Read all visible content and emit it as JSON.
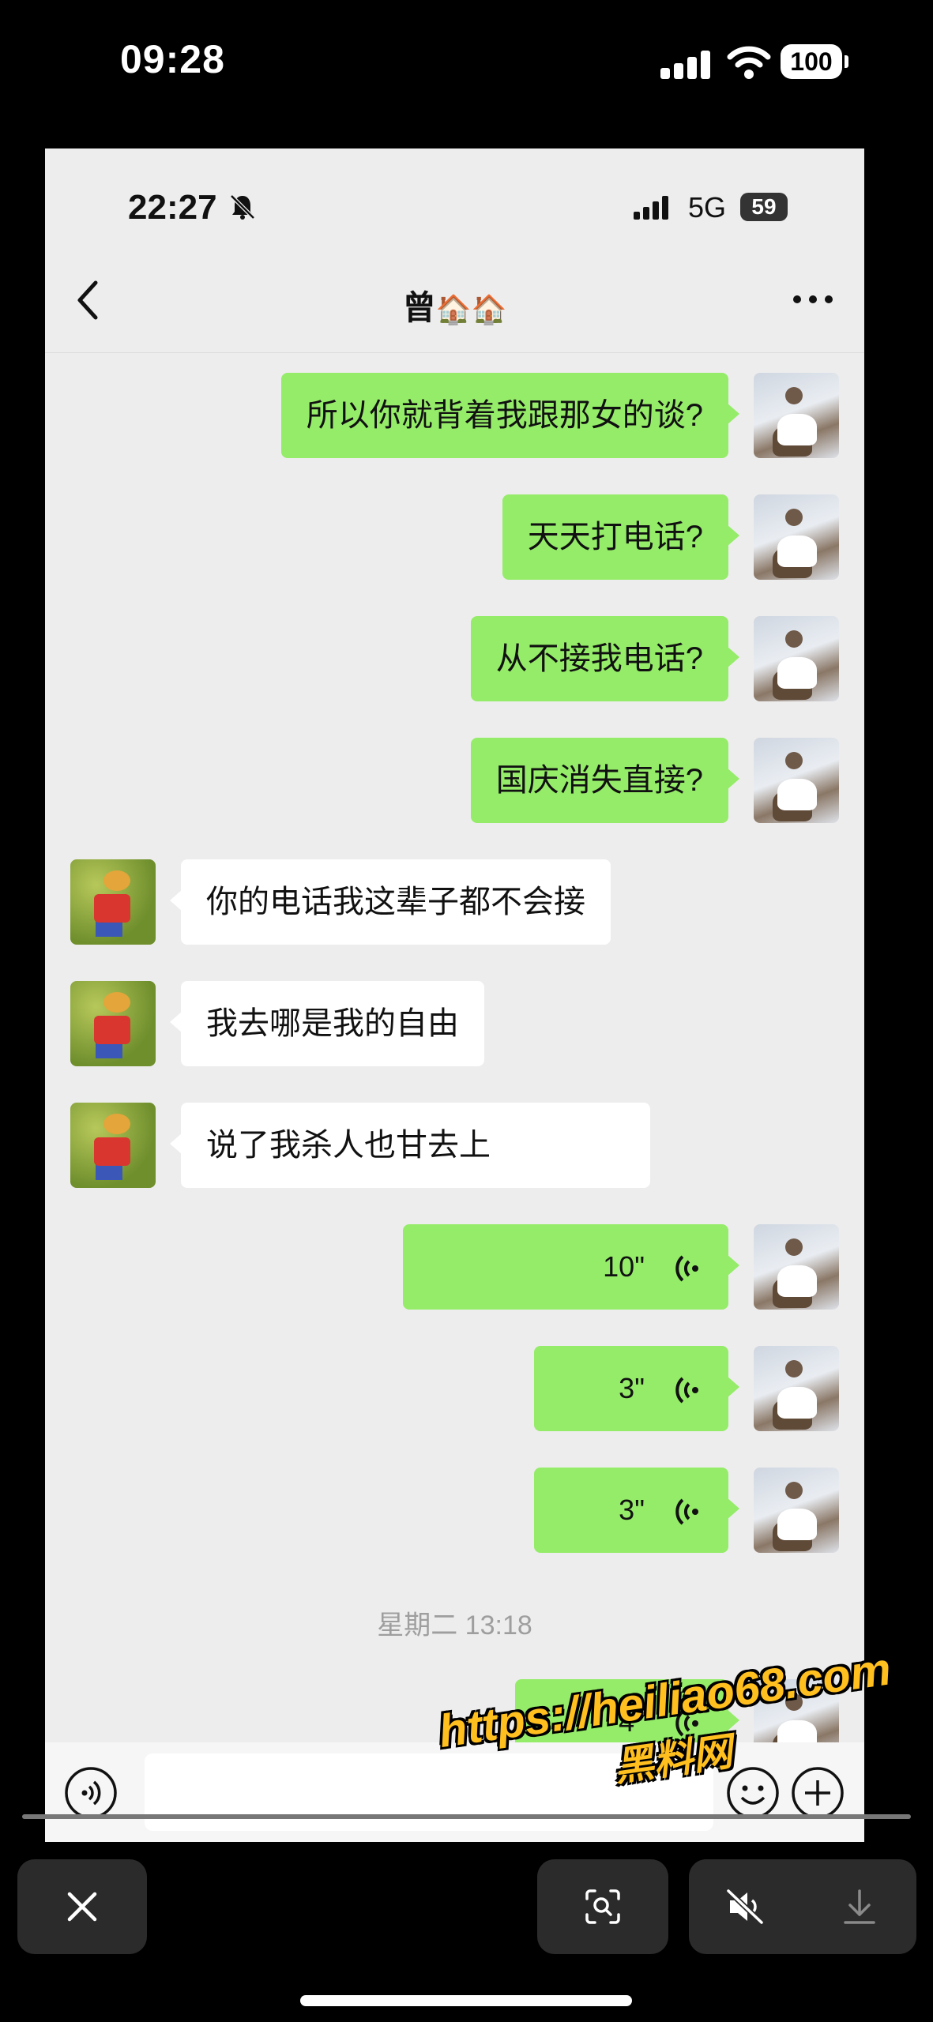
{
  "outer_status": {
    "time": "09:28",
    "battery": "100"
  },
  "inner_status": {
    "time": "22:27",
    "network": "5G",
    "battery": "59"
  },
  "chat": {
    "title": "曾",
    "title_icons": "🏠🏠",
    "messages": [
      {
        "side": "me",
        "text": "所以你就背着我跟那女的谈?"
      },
      {
        "side": "me",
        "text": "天天打电话?"
      },
      {
        "side": "me",
        "text": "从不接我电话?"
      },
      {
        "side": "me",
        "text": "国庆消失直接?"
      },
      {
        "side": "other",
        "text": "你的电话我这辈子都不会接"
      },
      {
        "side": "other",
        "text": "我去哪是我的自由"
      },
      {
        "side": "other",
        "text": "说了我杀人也甘去上"
      },
      {
        "side": "me",
        "type": "voice",
        "duration": "10\""
      },
      {
        "side": "me",
        "type": "voice",
        "duration": "3\""
      },
      {
        "side": "me",
        "type": "voice",
        "duration": "3\""
      },
      {
        "side": "me",
        "type": "voice",
        "duration": "4\""
      }
    ],
    "time_divider": "星期二 13:18"
  },
  "watermark": {
    "url": "https://heiliao68.com",
    "name": "黑料网"
  },
  "viewer": {
    "progress": 0.0
  },
  "colors": {
    "my_bubble": "#95ec69",
    "other_bubble": "#ffffff",
    "chat_bg": "#ededed",
    "watermark": "#ffbf1f"
  }
}
